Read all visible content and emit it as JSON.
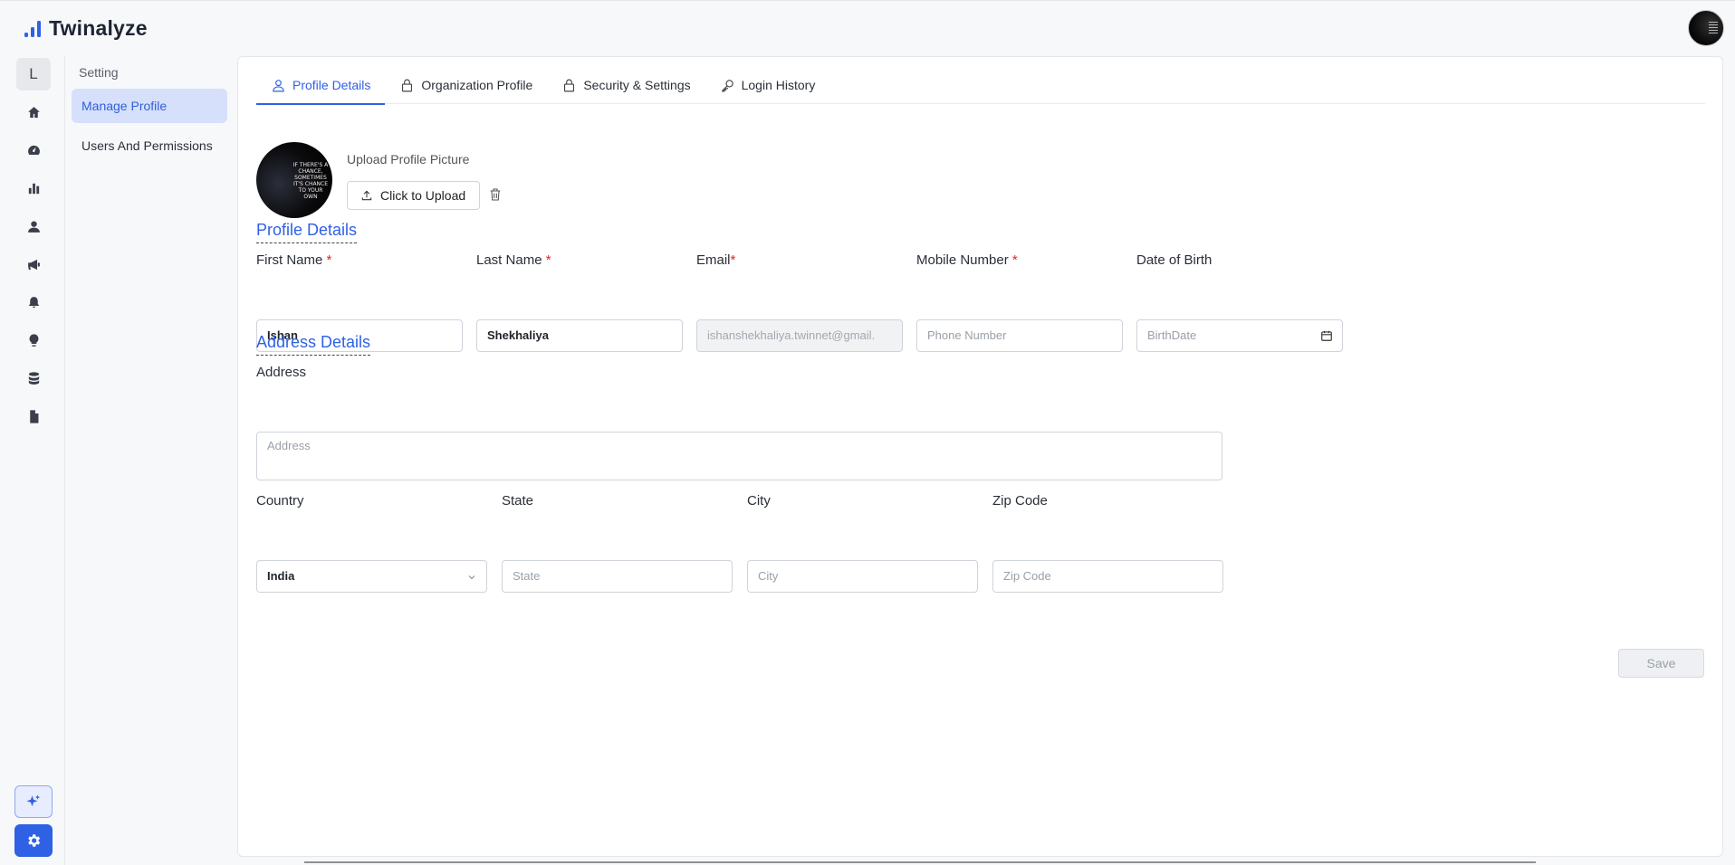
{
  "app": {
    "name": "Twinalyze"
  },
  "rail": {
    "letter": "L",
    "icons": [
      "home-icon",
      "dashboard-icon",
      "bar-chart-icon",
      "user-icon",
      "megaphone-icon",
      "bell-icon",
      "lightbulb-icon",
      "database-icon",
      "document-icon"
    ],
    "bottom": [
      "sparkle-icon",
      "settings-icon"
    ]
  },
  "subnav": {
    "title": "Setting",
    "items": [
      {
        "label": "Manage Profile",
        "active": true
      },
      {
        "label": "Users And Permissions",
        "active": false
      }
    ]
  },
  "tabs": [
    {
      "label": "Profile Details",
      "icon": "user-icon",
      "active": true
    },
    {
      "label": "Organization Profile",
      "icon": "lock-icon",
      "active": false
    },
    {
      "label": "Security & Settings",
      "icon": "lock-icon",
      "active": false
    },
    {
      "label": "Login History",
      "icon": "key-icon",
      "active": false
    }
  ],
  "upload": {
    "label": "Upload Profile Picture",
    "button": "Click to Upload",
    "picture_text": "IF THERE'S A CHANCE, SOMETIMES IT'S CHANCE TO YOUR OWN"
  },
  "profile": {
    "section_title": "Profile Details",
    "first_name": {
      "label": "First Name",
      "value": "Ishan"
    },
    "last_name": {
      "label": "Last Name",
      "value": "Shekhaliya"
    },
    "email": {
      "label": "Email",
      "value": "ishanshekhaliya.twinnet@gmail."
    },
    "mobile": {
      "label": "Mobile Number",
      "placeholder": "Phone Number"
    },
    "dob": {
      "label": "Date of Birth",
      "placeholder": "BirthDate"
    }
  },
  "address": {
    "section_title": "Address Details",
    "address": {
      "label": "Address",
      "placeholder": "Address"
    },
    "country": {
      "label": "Country",
      "value": "India"
    },
    "state": {
      "label": "State",
      "placeholder": "State"
    },
    "city": {
      "label": "City",
      "placeholder": "City"
    },
    "zip": {
      "label": "Zip Code",
      "placeholder": "Zip Code"
    }
  },
  "actions": {
    "save": "Save"
  },
  "colors": {
    "accent": "#2f61e5",
    "required": "#e02424"
  }
}
